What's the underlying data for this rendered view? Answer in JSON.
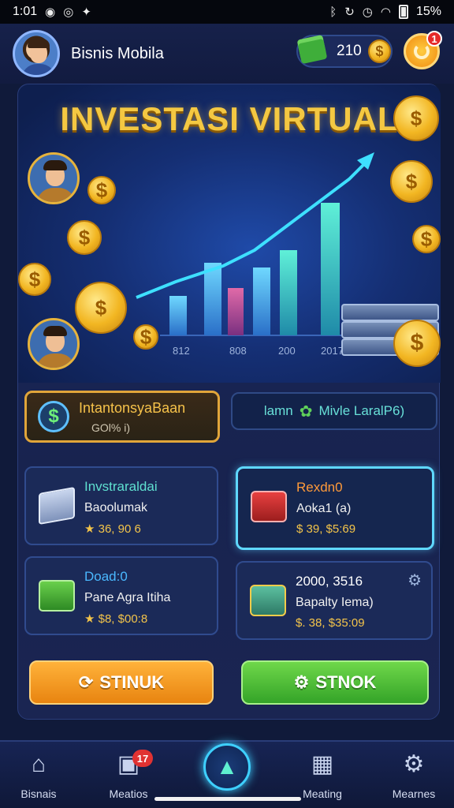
{
  "status_bar": {
    "time": "1:01",
    "battery": "15%",
    "left_icons": [
      "notification-icon",
      "notification-icon",
      "app-icon"
    ],
    "right_icons": [
      "bluetooth-icon",
      "sync-icon",
      "alarm-icon",
      "wifi-icon"
    ]
  },
  "header": {
    "username": "Bisnis Mobila",
    "coins": "210",
    "coin_symbol": "$",
    "notification_count": "1"
  },
  "hero": {
    "title": "INVESTASI VIRTUAL",
    "coin_symbol": "$",
    "chart_labels": [
      "812",
      "808",
      "200",
      "2017"
    ]
  },
  "banners": {
    "left": {
      "title": "IntantonsyaBaan",
      "subtitle": "GOl% i)",
      "icon": "$"
    },
    "right": {
      "text_a": "lamn",
      "text_b": "Mivle LaralP6)"
    }
  },
  "cards": [
    {
      "title": "Invstraraldai",
      "subtitle": "Baoolumak",
      "value": "36, 90 6",
      "prefix": "★",
      "title_color": "#5fe0d0",
      "icon": "book-stack-icon"
    },
    {
      "title": "Rexdn0",
      "subtitle": "Aoka1 (a)",
      "value": "39, $5:69",
      "prefix": "$",
      "title_color": "#ff9a3a",
      "icon": "red-briefcase-icon"
    },
    {
      "title": "Doad:0",
      "subtitle": "Pane Agra Itiha",
      "value": "$8, $00:8",
      "prefix": "★",
      "title_color": "#4ab8ff",
      "icon": "green-box-icon"
    },
    {
      "title": "2000, 3516",
      "subtitle": "Bapalty Iema)",
      "value": "$. 38, $35:09",
      "prefix": "",
      "title_color": "#ffffff",
      "icon": "treasure-chest-icon"
    }
  ],
  "actions": {
    "left_label": "STINUK",
    "right_label": "STNOK"
  },
  "nav": [
    {
      "label": "Bisnais",
      "icon": "home-icon"
    },
    {
      "label": "Meatios",
      "icon": "stats-icon",
      "badge": "17"
    },
    {
      "label": "",
      "icon": "rocket-icon"
    },
    {
      "label": "Meating",
      "icon": "grid-icon"
    },
    {
      "label": "Mearnes",
      "icon": "gear-icon"
    }
  ]
}
